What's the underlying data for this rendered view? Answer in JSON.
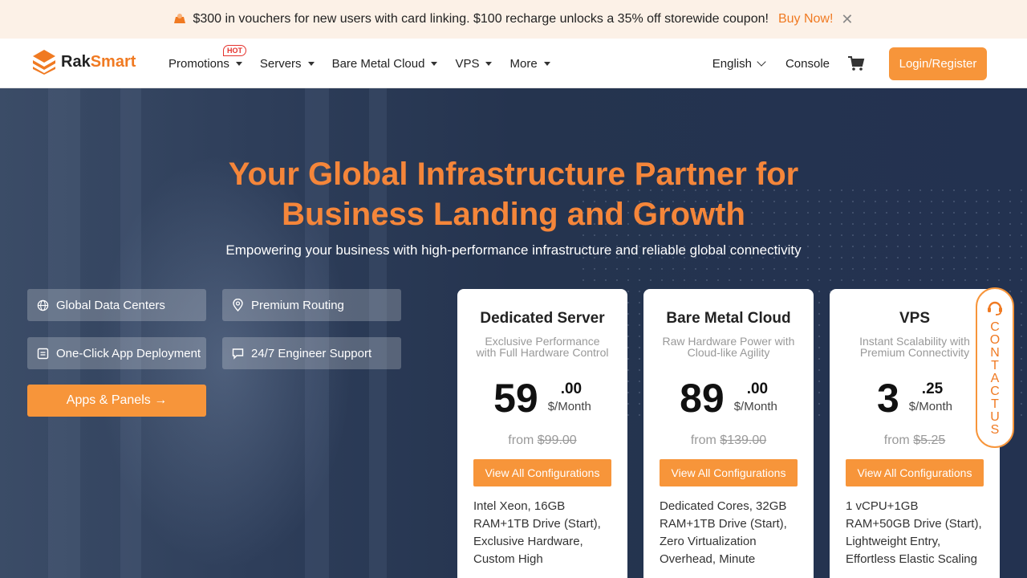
{
  "promo": {
    "text": "$300 in vouchers for new users with card linking. $100 recharge unlocks a 35% off storewide coupon!",
    "buy_now": "Buy Now!",
    "close": "✕"
  },
  "header": {
    "logo": "RakSmart",
    "nav": [
      {
        "label": "Promotions",
        "badge": "HOT"
      },
      {
        "label": "Servers"
      },
      {
        "label": "Bare Metal Cloud"
      },
      {
        "label": "VPS"
      },
      {
        "label": "More"
      }
    ],
    "language": "English",
    "console": "Console",
    "login": "Login/Register"
  },
  "hero": {
    "title_line1": "Your Global Infrastructure Partner for",
    "title_line2": "Business Landing and Growth",
    "subtitle": "Empowering your business with high-performance infrastructure and reliable global connectivity",
    "features": [
      {
        "label": "Global Data Centers",
        "icon": "globe-icon"
      },
      {
        "label": "Premium Routing",
        "icon": "location-pin-icon"
      },
      {
        "label": "One-Click App Deployment",
        "icon": "app-icon"
      },
      {
        "label": "24/7 Engineer Support",
        "icon": "chat-icon"
      }
    ],
    "apps_button": "Apps & Panels →"
  },
  "cards": [
    {
      "title": "Dedicated Server",
      "subtitle": "Exclusive Performance with Full Hardware Control",
      "price_int": "59",
      "price_cents": ".00",
      "per": "$/Month",
      "from_label": "from",
      "old_price": "$99.00",
      "button": "View All Configurations",
      "desc": "Intel Xeon, 16GB RAM+1TB Drive (Start), Exclusive Hardware, Custom High"
    },
    {
      "title": "Bare Metal Cloud",
      "subtitle": "Raw Hardware Power with Cloud-like Agility",
      "price_int": "89",
      "price_cents": ".00",
      "per": "$/Month",
      "from_label": "from",
      "old_price": "$139.00",
      "button": "View All Configurations",
      "desc": "Dedicated Cores, 32GB RAM+1TB Drive (Start), Zero Virtualization Overhead, Minute"
    },
    {
      "title": "VPS",
      "subtitle": "Instant Scalability with Premium Connectivity",
      "price_int": "3",
      "price_cents": ".25",
      "per": "$/Month",
      "from_label": "from",
      "old_price": "$5.25",
      "button": "View All Configurations",
      "desc": "1 vCPU+1GB RAM+50GB Drive (Start), Lightweight Entry, Effortless Elastic Scaling"
    }
  ],
  "contact": {
    "label": "CONTACT US"
  },
  "colors": {
    "accent": "#f7953a",
    "title": "#f5863a",
    "hero_bg": "#25344f"
  }
}
